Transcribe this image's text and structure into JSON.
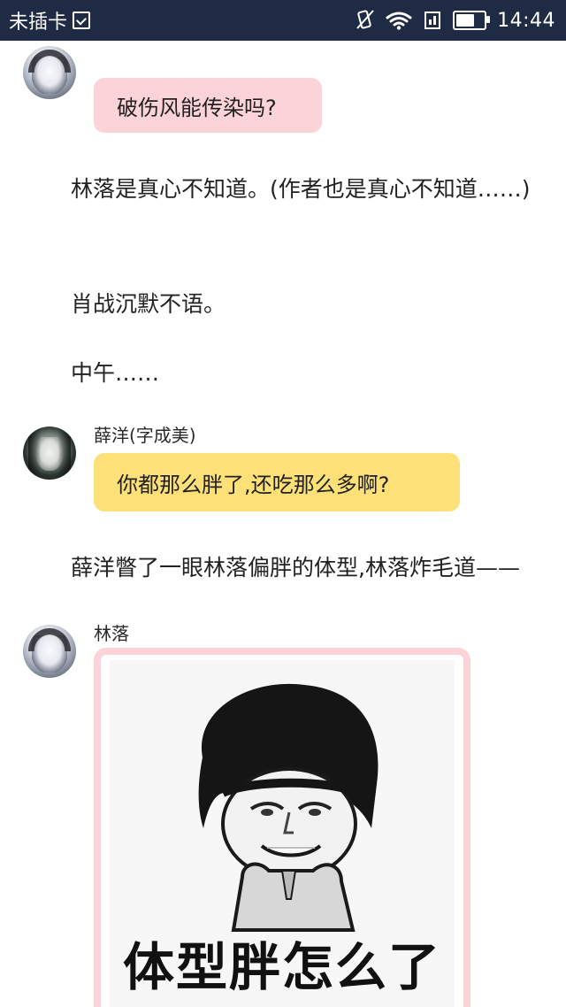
{
  "status_bar": {
    "carrier": "未插卡",
    "time": "14:44",
    "battery_level": 0.7,
    "icons": [
      "sim-card-icon",
      "vibrate-icon",
      "wifi-icon",
      "sim-slot-icon",
      "battery-icon"
    ]
  },
  "chat": [
    {
      "type": "message",
      "speaker": "林落",
      "avatar": "avatar-lin",
      "bubble_color": "#fcd3d9",
      "text": "破伤风能传染吗?"
    },
    {
      "type": "narration",
      "text": "林落是真心不知道。(作者也是真心不知道……)"
    },
    {
      "type": "narration",
      "text": "肖战沉默不语。"
    },
    {
      "type": "narration",
      "text": "中午……"
    },
    {
      "type": "message",
      "speaker": "薛洋(字成美)",
      "avatar": "avatar-xue",
      "bubble_color": "#fde078",
      "text": "你都那么胖了,还吃那么多啊?"
    },
    {
      "type": "narration",
      "text": "薛洋瞥了一眼林落偏胖的体型,林落炸毛道——"
    },
    {
      "type": "sticker",
      "speaker": "林落",
      "avatar": "avatar-lin",
      "sticker_caption": "体型胖怎么了",
      "bubble_color": "#fcd3d9"
    }
  ]
}
